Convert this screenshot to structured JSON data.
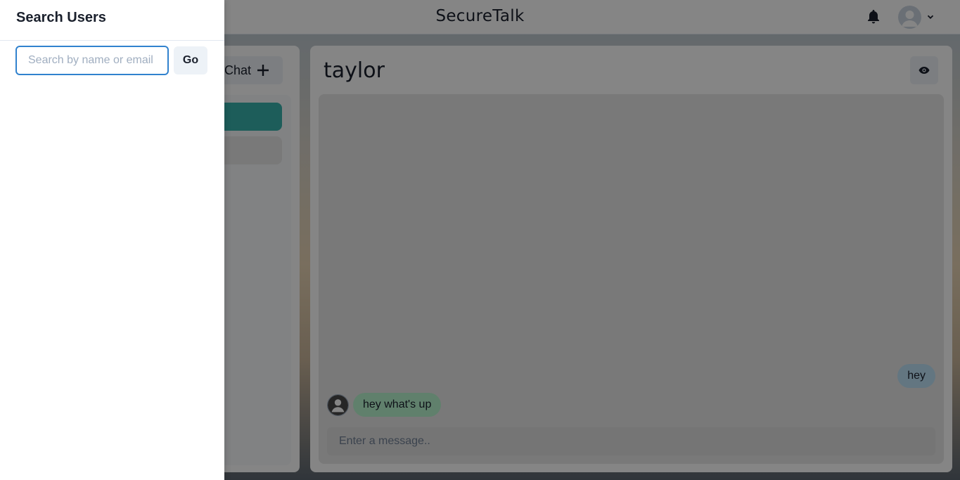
{
  "header": {
    "app_title": "SecureTalk",
    "icons": {
      "notification": "bell-icon",
      "avatar": "user-avatar-icon",
      "menu": "chevron-down-icon"
    }
  },
  "chats_panel": {
    "new_chat_label": "Chat",
    "new_chat_icon": "plus-icon",
    "accent_color": "#38b2ac"
  },
  "chatbox": {
    "chat_name": "taylor",
    "view_icon": "eye-icon",
    "messages": [
      {
        "text": "hey",
        "from": "self"
      },
      {
        "text": "hey what's up",
        "from": "other"
      }
    ],
    "input_placeholder": "Enter a message.."
  },
  "drawer": {
    "title": "Search Users",
    "search_placeholder": "Search by name or email",
    "search_value": "",
    "go_label": "Go"
  }
}
